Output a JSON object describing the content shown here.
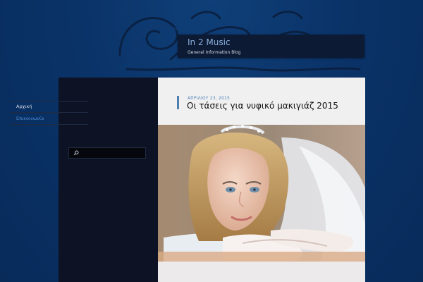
{
  "site": {
    "title": "In 2 Music",
    "description": "General Information Blog"
  },
  "sidebar": {
    "nav": [
      {
        "label": "Αρχική"
      },
      {
        "label": "Επικοινωνία"
      }
    ],
    "search": {
      "placeholder": ""
    }
  },
  "post": {
    "date": "ΑΠΡΙΛΙΟΥ 23, 2015",
    "title": "Οι τάσεις για νυφικό μακιγιάζ 2015"
  },
  "colors": {
    "background": "#0a3368",
    "sidebar": "#0d1325",
    "accent": "#4f84b8",
    "header_box": "#0c1a33"
  }
}
